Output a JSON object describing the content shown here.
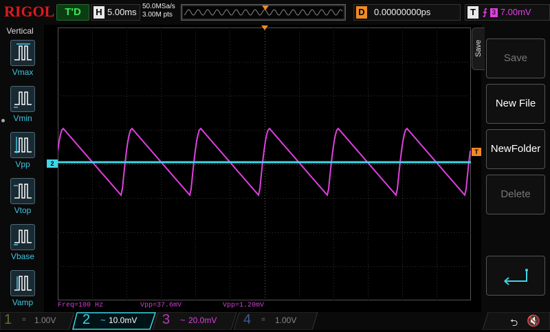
{
  "header": {
    "brand": "RIGOL",
    "run_status": "T'D",
    "timebase_key": "H",
    "timebase_value": "5.00ms",
    "sample_rate": "50.0MSa/s",
    "memory_depth": "3.00M pts",
    "delay_key": "D",
    "delay_value": "0.00000000ps",
    "trigger_key": "T",
    "trigger_source": "3",
    "trigger_level": "7.00mV"
  },
  "left_menu": {
    "title": "Vertical",
    "items": [
      {
        "label": "Vmax",
        "icon": "vmax-icon"
      },
      {
        "label": "Vmin",
        "icon": "vmin-icon"
      },
      {
        "label": "Vpp",
        "icon": "vpp-icon"
      },
      {
        "label": "Vtop",
        "icon": "vtop-icon"
      },
      {
        "label": "Vbase",
        "icon": "vbase-icon"
      },
      {
        "label": "Vamp",
        "icon": "vamp-icon"
      }
    ]
  },
  "markers": {
    "ch2": "2",
    "trigger": "T"
  },
  "measurements": [
    {
      "text": "Freq=100 Hz"
    },
    {
      "text": "Vpp=37.6mV"
    },
    {
      "text": "Vpp=1.20mV"
    }
  ],
  "right_menu": {
    "tab_label": "Save",
    "buttons": [
      {
        "label": "Save",
        "enabled": false
      },
      {
        "label": "New File",
        "enabled": true
      },
      {
        "label": "NewFolder",
        "enabled": true
      },
      {
        "label": "Delete",
        "enabled": false
      },
      {
        "label": "",
        "icon": "return-arrow-icon",
        "enabled": true
      }
    ]
  },
  "channels": [
    {
      "num": "1",
      "coupling": "=",
      "scale": "1.00V",
      "color": "#c8c81e",
      "active": false
    },
    {
      "num": "2",
      "coupling": "~",
      "scale": "10.0mV",
      "color": "#3fd6e6",
      "active": true
    },
    {
      "num": "3",
      "coupling": "~",
      "scale": "20.0mV",
      "color": "#e040e0",
      "active": false
    },
    {
      "num": "4",
      "coupling": "=",
      "scale": "1.00V",
      "color": "#3d7ad0",
      "active": false
    }
  ],
  "colors": {
    "ch2": "#3fd6e6",
    "ch3": "#e040e0",
    "trigger": "#f08a24",
    "brand": "#e0191d"
  }
}
